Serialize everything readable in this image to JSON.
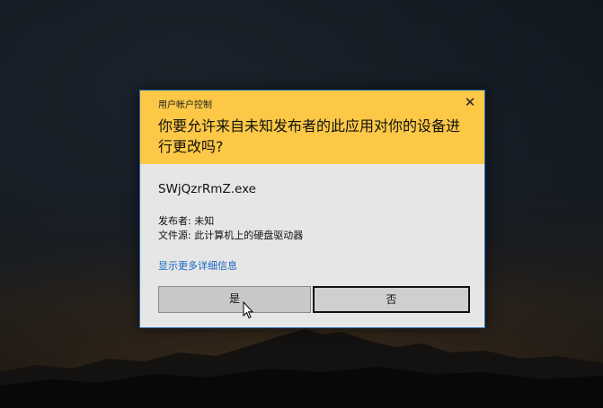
{
  "uac": {
    "title": "用户帐户控制",
    "close_glyph": "✕",
    "question": "你要允许来自未知发布者的此应用对你的设备进行更改吗?",
    "program_name": "SWjQzrRmZ.exe",
    "publisher_label": "发布者: 未知",
    "origin_label": "文件源: 此计算机上的硬盘驱动器",
    "details_link": "显示更多详细信息",
    "yes_button": "是",
    "no_button": "否"
  },
  "colors": {
    "header": "#fcc846",
    "dialog_bg": "#e6e6e6",
    "link": "#1565c0",
    "border": "#2a6fb2"
  }
}
